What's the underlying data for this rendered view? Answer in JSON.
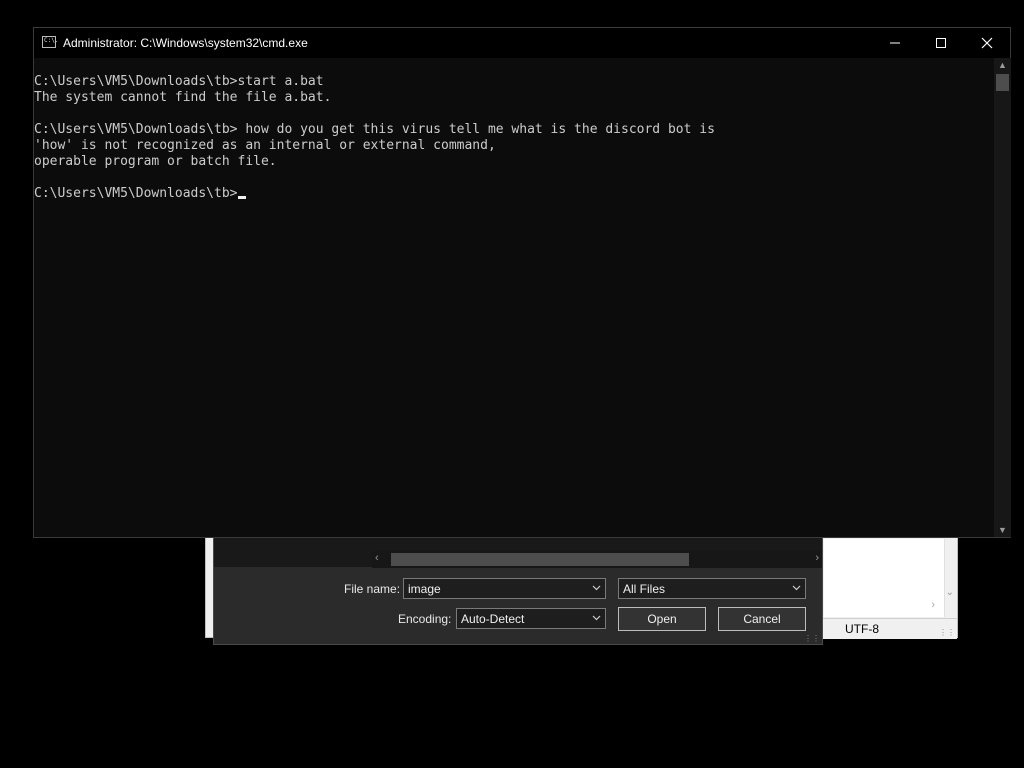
{
  "cmd_window": {
    "title": "Administrator: C:\\Windows\\system32\\cmd.exe",
    "icon_text": "C:\\.",
    "lines": [
      "C:\\Users\\VM5\\Downloads\\tb>start a.bat",
      "The system cannot find the file a.bat.",
      "",
      "C:\\Users\\VM5\\Downloads\\tb> how do you get this virus tell me what is the discord bot is",
      "'how' is not recognized as an internal or external command,",
      "operable program or batch file.",
      "",
      "C:\\Users\\VM5\\Downloads\\tb>"
    ],
    "controls": [
      "minimize-icon",
      "maximize-icon",
      "close-icon"
    ]
  },
  "open_dialog": {
    "file_name_label": "File name:",
    "file_name_value": "image",
    "file_type_value": "All Files",
    "encoding_label": "Encoding:",
    "encoding_value": "Auto-Detect",
    "open_label": "Open",
    "cancel_label": "Cancel"
  },
  "notepad_status": {
    "encoding": "UTF-8"
  },
  "colors": {
    "console_bg": "#0c0c0c",
    "console_text": "#cccccc",
    "dialog_bg": "#2b2b2b"
  }
}
